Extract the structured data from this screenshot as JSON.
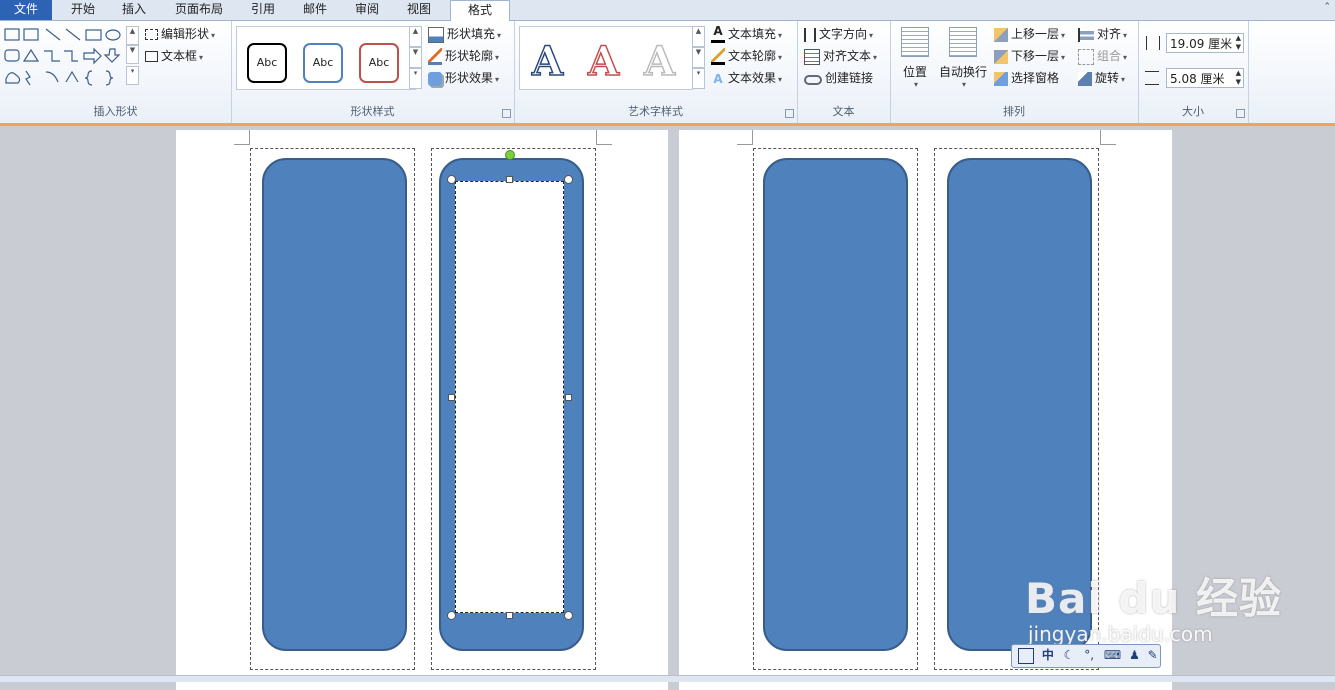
{
  "tabs": [
    {
      "label": "文件"
    },
    {
      "label": "开始"
    },
    {
      "label": "插入"
    },
    {
      "label": "页面布局"
    },
    {
      "label": "引用"
    },
    {
      "label": "邮件"
    },
    {
      "label": "审阅"
    },
    {
      "label": "视图"
    },
    {
      "label": "格式"
    }
  ],
  "active_tab": "格式",
  "groups": {
    "insert_shapes": {
      "label": "插入形状",
      "edit_shape": "编辑形状",
      "text_box": "文本框"
    },
    "shape_styles": {
      "label": "形状样式",
      "samples": [
        "Abc",
        "Abc",
        "Abc"
      ],
      "sample_colors": [
        "#000000",
        "#4f81bd",
        "#c0504d"
      ],
      "fill": "形状填充",
      "outline": "形状轮廓",
      "effects": "形状效果"
    },
    "wordart_styles": {
      "label": "艺术字样式",
      "letters": [
        "A",
        "A",
        "A"
      ],
      "text_fill": "文本填充",
      "text_outline": "文本轮廓",
      "text_effects": "文本效果"
    },
    "text": {
      "label": "文本",
      "direction": "文字方向",
      "align": "对齐文本",
      "link": "创建链接"
    },
    "arrange": {
      "label": "排列",
      "position": "位置",
      "wrap": "自动换行",
      "bring_forward": "上移一层",
      "send_backward": "下移一层",
      "selection_pane": "选择窗格",
      "align": "对齐",
      "group": "组合",
      "rotate": "旋转"
    },
    "size": {
      "label": "大小",
      "height": "19.09 厘米",
      "width": "5.08 厘米"
    }
  },
  "colors": {
    "shape_fill": "#4f81bd",
    "shape_border": "#385d8a",
    "accent_tab": "#2d63b5"
  },
  "ime_bar": {
    "label": "中"
  },
  "watermark": {
    "brand": "Bai du 经验",
    "url": "jingyan.baidu.com"
  }
}
